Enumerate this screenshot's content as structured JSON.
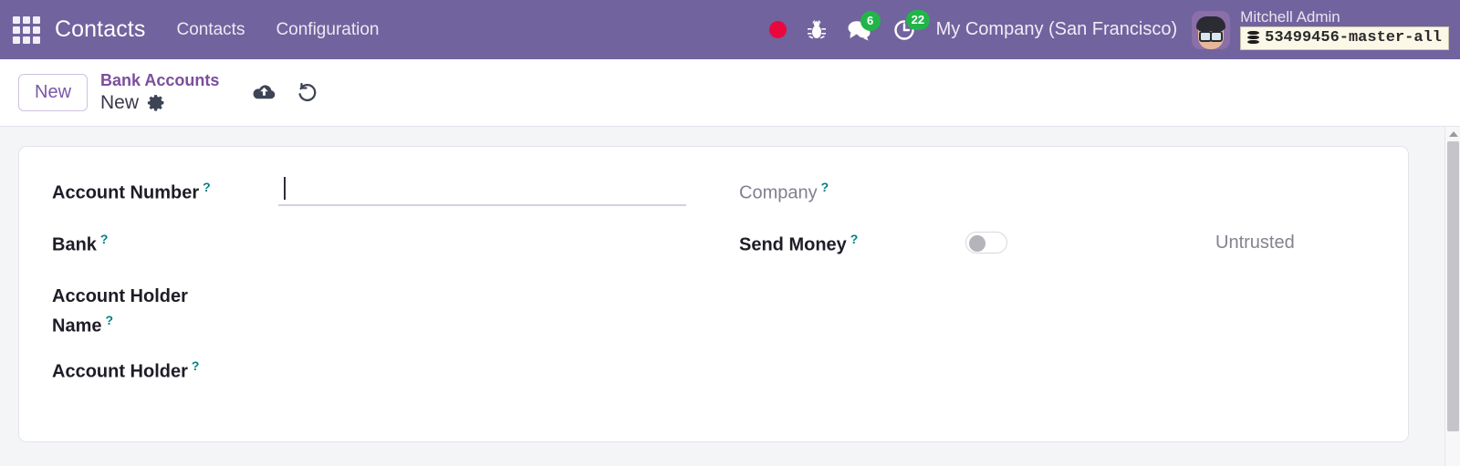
{
  "navbar": {
    "apps_icon": "apps-grid-icon",
    "brand": "Contacts",
    "menus": [
      {
        "label": "Contacts"
      },
      {
        "label": "Configuration"
      }
    ],
    "system_icons": [
      {
        "name": "recording-dot-icon",
        "label": ""
      },
      {
        "name": "bug-icon",
        "label": ""
      },
      {
        "name": "messages-icon",
        "badge": "6"
      },
      {
        "name": "activities-clock-icon",
        "badge": "22"
      }
    ],
    "company": "My Company (San Francisco)",
    "user_name": "Mitchell Admin",
    "database": "53499456-master-all",
    "badge_color": "#21b549",
    "brand_color": "#71639e"
  },
  "control_panel": {
    "new_button": "New",
    "breadcrumb_parent": "Bank Accounts",
    "breadcrumb_current": "New",
    "gear_icon": "gear-icon",
    "save_icon": "cloud-upload-icon",
    "discard_icon": "undo-icon"
  },
  "form": {
    "left_fields": [
      {
        "label": "Account Number",
        "help": "?",
        "value": "",
        "placeholder": ""
      },
      {
        "label": "Bank",
        "help": "?",
        "value": "",
        "placeholder": ""
      },
      {
        "label_line1": "Account Holder",
        "label_line2": "Name",
        "help": "?",
        "value": "",
        "placeholder": ""
      },
      {
        "label": "Account Holder",
        "help": "?",
        "value": "",
        "placeholder": ""
      }
    ],
    "right_fields": [
      {
        "label": "Company",
        "help": "?",
        "value": "",
        "readonly": true
      },
      {
        "label": "Send Money",
        "help": "?",
        "toggle_on": false,
        "trust_status": "Untrusted"
      }
    ],
    "help_marker": "?",
    "help_color": "#017e84"
  },
  "scrollbar": {
    "up_arrow": "scroll-up-arrow-icon"
  }
}
